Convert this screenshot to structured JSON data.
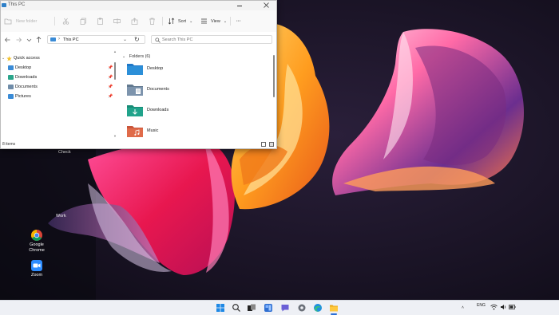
{
  "window": {
    "title": "This PC",
    "commands": {
      "new_folder": "New folder",
      "sort": "Sort",
      "view": "View",
      "more": "···"
    },
    "address": {
      "crumb": "This PC",
      "search_placeholder": "Search This PC"
    },
    "nav": {
      "items": [
        {
          "label": "Quick access",
          "icon": "star-icon",
          "color": "#f2c12e",
          "pinned": false
        },
        {
          "label": "Desktop",
          "icon": "desktop-folder-icon",
          "color": "#3a8bd6",
          "pinned": true
        },
        {
          "label": "Downloads",
          "icon": "downloads-folder-icon",
          "color": "#2aa58a",
          "pinned": true
        },
        {
          "label": "Documents",
          "icon": "documents-folder-icon",
          "color": "#6f8ca8",
          "pinned": true
        },
        {
          "label": "Pictures",
          "icon": "pictures-folder-icon",
          "color": "#3a8bd6",
          "pinned": true
        }
      ]
    },
    "content": {
      "group_header": "Folders (6)",
      "folders": [
        {
          "label": "Desktop",
          "icon": "desktop-folder-icon",
          "color": "#2c8fd8"
        },
        {
          "label": "Documents",
          "icon": "documents-folder-icon",
          "color": "#7d94ad"
        },
        {
          "label": "Downloads",
          "icon": "downloads-folder-icon",
          "color": "#21a38b"
        },
        {
          "label": "Music",
          "icon": "music-folder-icon",
          "color": "#e06b4a"
        }
      ]
    },
    "status": "8 items"
  },
  "desktop": {
    "icons": [
      {
        "label_line1": "Google",
        "label_line2": "Chrome",
        "icon": "chrome-icon"
      },
      {
        "label_line1": "Zoom",
        "label_line2": "",
        "icon": "zoom-icon"
      }
    ],
    "labels": {
      "check": "Check",
      "work": "Work"
    }
  },
  "taskbar": {
    "icons": [
      "windows-start-icon",
      "search-icon",
      "task-view-icon",
      "widgets-icon",
      "chat-icon",
      "settings-icon",
      "edge-icon",
      "file-explorer-icon"
    ],
    "tray_language": "ENG",
    "accent": "#2b6fd6"
  }
}
